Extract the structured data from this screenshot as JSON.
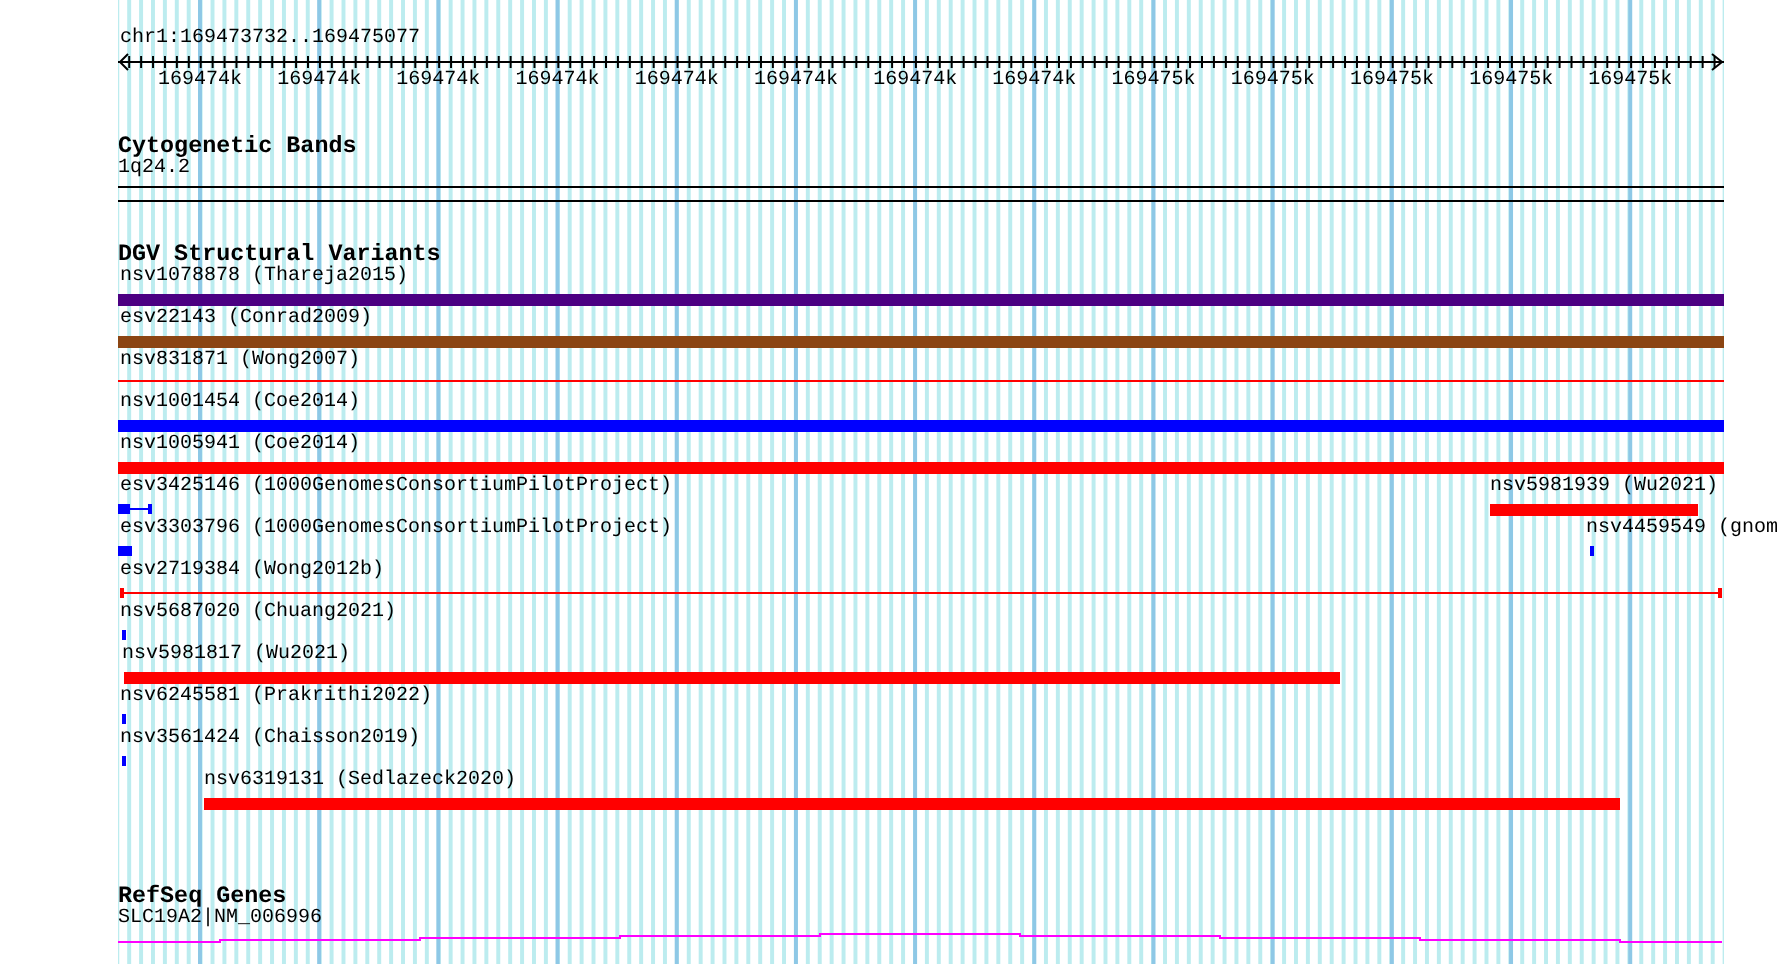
{
  "ruler": {
    "location": "chr1:169473732..169475077",
    "tick_labels": [
      "169474k",
      "169474k",
      "169474k",
      "169474k",
      "169474k",
      "169474k",
      "169474k",
      "169474k",
      "169475k",
      "169475k",
      "169475k",
      "169475k",
      "169475k"
    ]
  },
  "cytogenetic_bands": {
    "title": "Cytogenetic Bands",
    "band_label": "1q24.2"
  },
  "dgv_structural_variants": {
    "title": "DGV Structural Variants",
    "rows": [
      {
        "features": [
          {
            "label": "nsv1078878 (Thareja2015)",
            "kind": "bar",
            "color": "#4b0082"
          }
        ]
      },
      {
        "features": [
          {
            "label": "esv22143 (Conrad2009)",
            "kind": "bar",
            "color": "#8b4513"
          }
        ]
      },
      {
        "features": [
          {
            "label": "nsv831871 (Wong2007)",
            "kind": "line",
            "color": "#ff0000"
          }
        ]
      },
      {
        "features": [
          {
            "label": "nsv1001454 (Coe2014)",
            "kind": "bar",
            "color": "#0000ff"
          }
        ]
      },
      {
        "features": [
          {
            "label": "nsv1005941 (Coe2014)",
            "kind": "bar",
            "color": "#ff0000"
          }
        ]
      },
      {
        "features": [
          {
            "label": "esv3425146 (1000GenomesConsortiumPilotProject)",
            "kind": "box-line",
            "color": "#0000ff"
          },
          {
            "label": "nsv5981939 (Wu2021)",
            "kind": "bar",
            "color": "#ff0000"
          }
        ]
      },
      {
        "features": [
          {
            "label": "esv3303796 (1000GenomesConsortiumPilotProject)",
            "kind": "box",
            "color": "#0000ff"
          },
          {
            "label": "nsv4459549 (gnom",
            "kind": "box",
            "color": "#0000ff"
          }
        ]
      },
      {
        "features": [
          {
            "label": "esv2719384 (Wong2012b)",
            "kind": "line-capped",
            "color": "#ff0000"
          }
        ]
      },
      {
        "features": [
          {
            "label": "nsv5687020 (Chuang2021)",
            "kind": "box",
            "color": "#0000ff"
          }
        ]
      },
      {
        "features": [
          {
            "label": "nsv5981817 (Wu2021)",
            "kind": "bar",
            "color": "#ff0000"
          }
        ]
      },
      {
        "features": [
          {
            "label": "nsv6245581 (Prakrithi2022)",
            "kind": "box",
            "color": "#0000ff"
          }
        ]
      },
      {
        "features": [
          {
            "label": "nsv3561424 (Chaisson2019)",
            "kind": "box",
            "color": "#0000ff"
          }
        ]
      },
      {
        "features": [
          {
            "label": "nsv6319131 (Sedlazeck2020)",
            "kind": "bar",
            "color": "#ff0000"
          }
        ]
      }
    ]
  },
  "refseq_genes": {
    "title": "RefSeq Genes",
    "features": [
      {
        "label": "SLC19A2|NM_006996"
      }
    ]
  }
}
